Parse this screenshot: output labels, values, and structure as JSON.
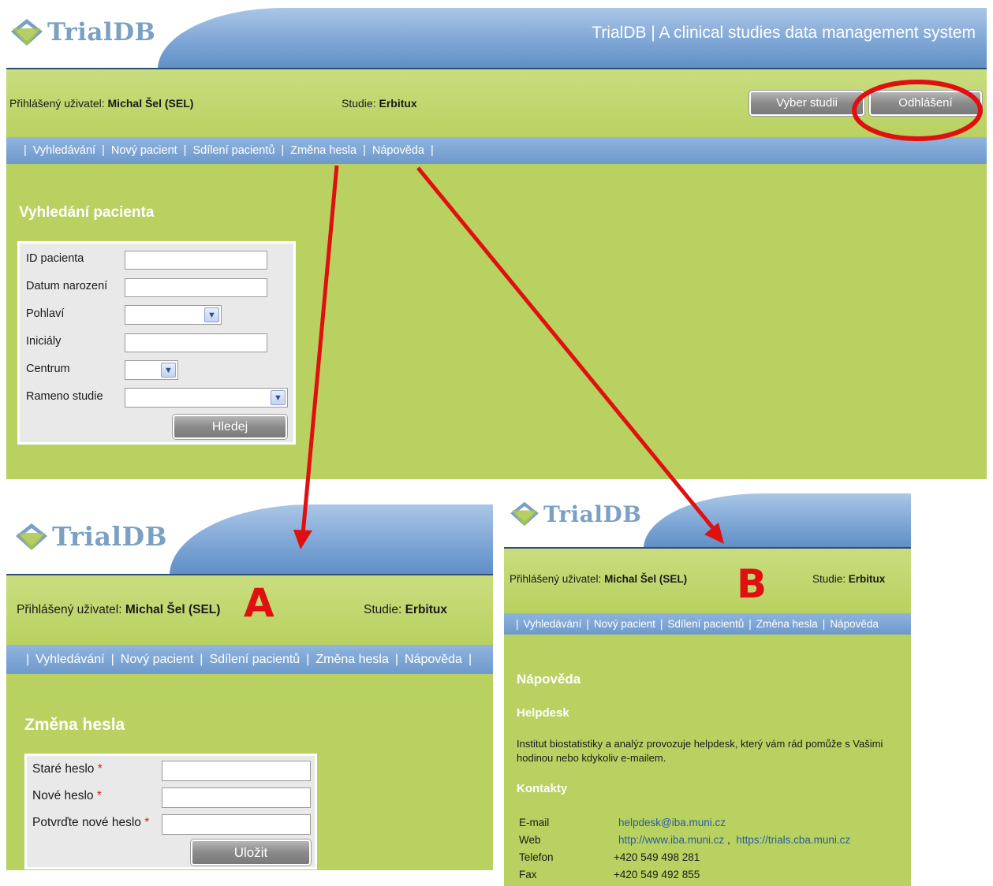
{
  "main": {
    "logo_text": "TrialDB",
    "app_title": "TrialDB | A clinical studies data management system",
    "user_label": "Přihlášený uživatel:",
    "user_name": "Michal Šel (SEL)",
    "study_label": "Studie:",
    "study_name": "Erbitux",
    "select_study_button": "Vyber studii",
    "logout_button": "Odhlášení",
    "nav": [
      "Vyhledávání",
      "Nový pacient",
      "Sdílení pacientů",
      "Změna hesla",
      "Nápověda"
    ],
    "section_title": "Vyhledání pacienta",
    "form": {
      "patient_id_label": "ID pacienta",
      "birth_date_label": "Datum narození",
      "sex_label": "Pohlaví",
      "initials_label": "Iniciály",
      "center_label": "Centrum",
      "study_arm_label": "Rameno studie",
      "search_button": "Hledej"
    }
  },
  "panel_a": {
    "letter": "A",
    "logo_text": "TrialDB",
    "user_label": "Přihlášený uživatel:",
    "user_name": "Michal Šel (SEL)",
    "study_label": "Studie:",
    "study_name": "Erbitux",
    "nav": [
      "Vyhledávání",
      "Nový pacient",
      "Sdílení pacientů",
      "Změna hesla",
      "Nápověda"
    ],
    "section_title": "Změna hesla",
    "form": {
      "old_password_label": "Staré heslo",
      "new_password_label": "Nové heslo",
      "confirm_password_label": "Potvrďte nové heslo",
      "required_mark": "*",
      "save_button": "Uložit"
    }
  },
  "panel_b": {
    "letter": "B",
    "logo_text": "TrialDB",
    "user_label": "Přihlášený uživatel:",
    "user_name": "Michal Šel (SEL)",
    "study_label": "Studie:",
    "study_name": "Erbitux",
    "nav": [
      "Vyhledávání",
      "Nový pacient",
      "Sdílení pacientů",
      "Změna hesla",
      "Nápověda"
    ],
    "section_title": "Nápověda",
    "helpdesk_title": "Helpdesk",
    "helpdesk_text_1": "Institut biostatistiky a analýz provozuje helpdesk, který vám rád pomůže s Vašimi",
    "helpdesk_text_2": "hodinou nebo kdykoliv e-mailem.",
    "contacts_title": "Kontakty",
    "contacts": {
      "email_label": "E-mail",
      "email_value": "helpdesk@iba.muni.cz",
      "web_label": "Web",
      "web_value_1": "http://www.iba.muni.cz",
      "web_sep": ",",
      "web_value_2": "https://trials.cba.muni.cz",
      "phone_label": "Telefon",
      "phone_value": "+420 549 498 281",
      "fax_label": "Fax",
      "fax_value": "+420 549 492 855"
    }
  },
  "colors": {
    "green": "#b9d160",
    "blue_bar": "#7ea6d6",
    "annotation_red": "#e01010"
  }
}
